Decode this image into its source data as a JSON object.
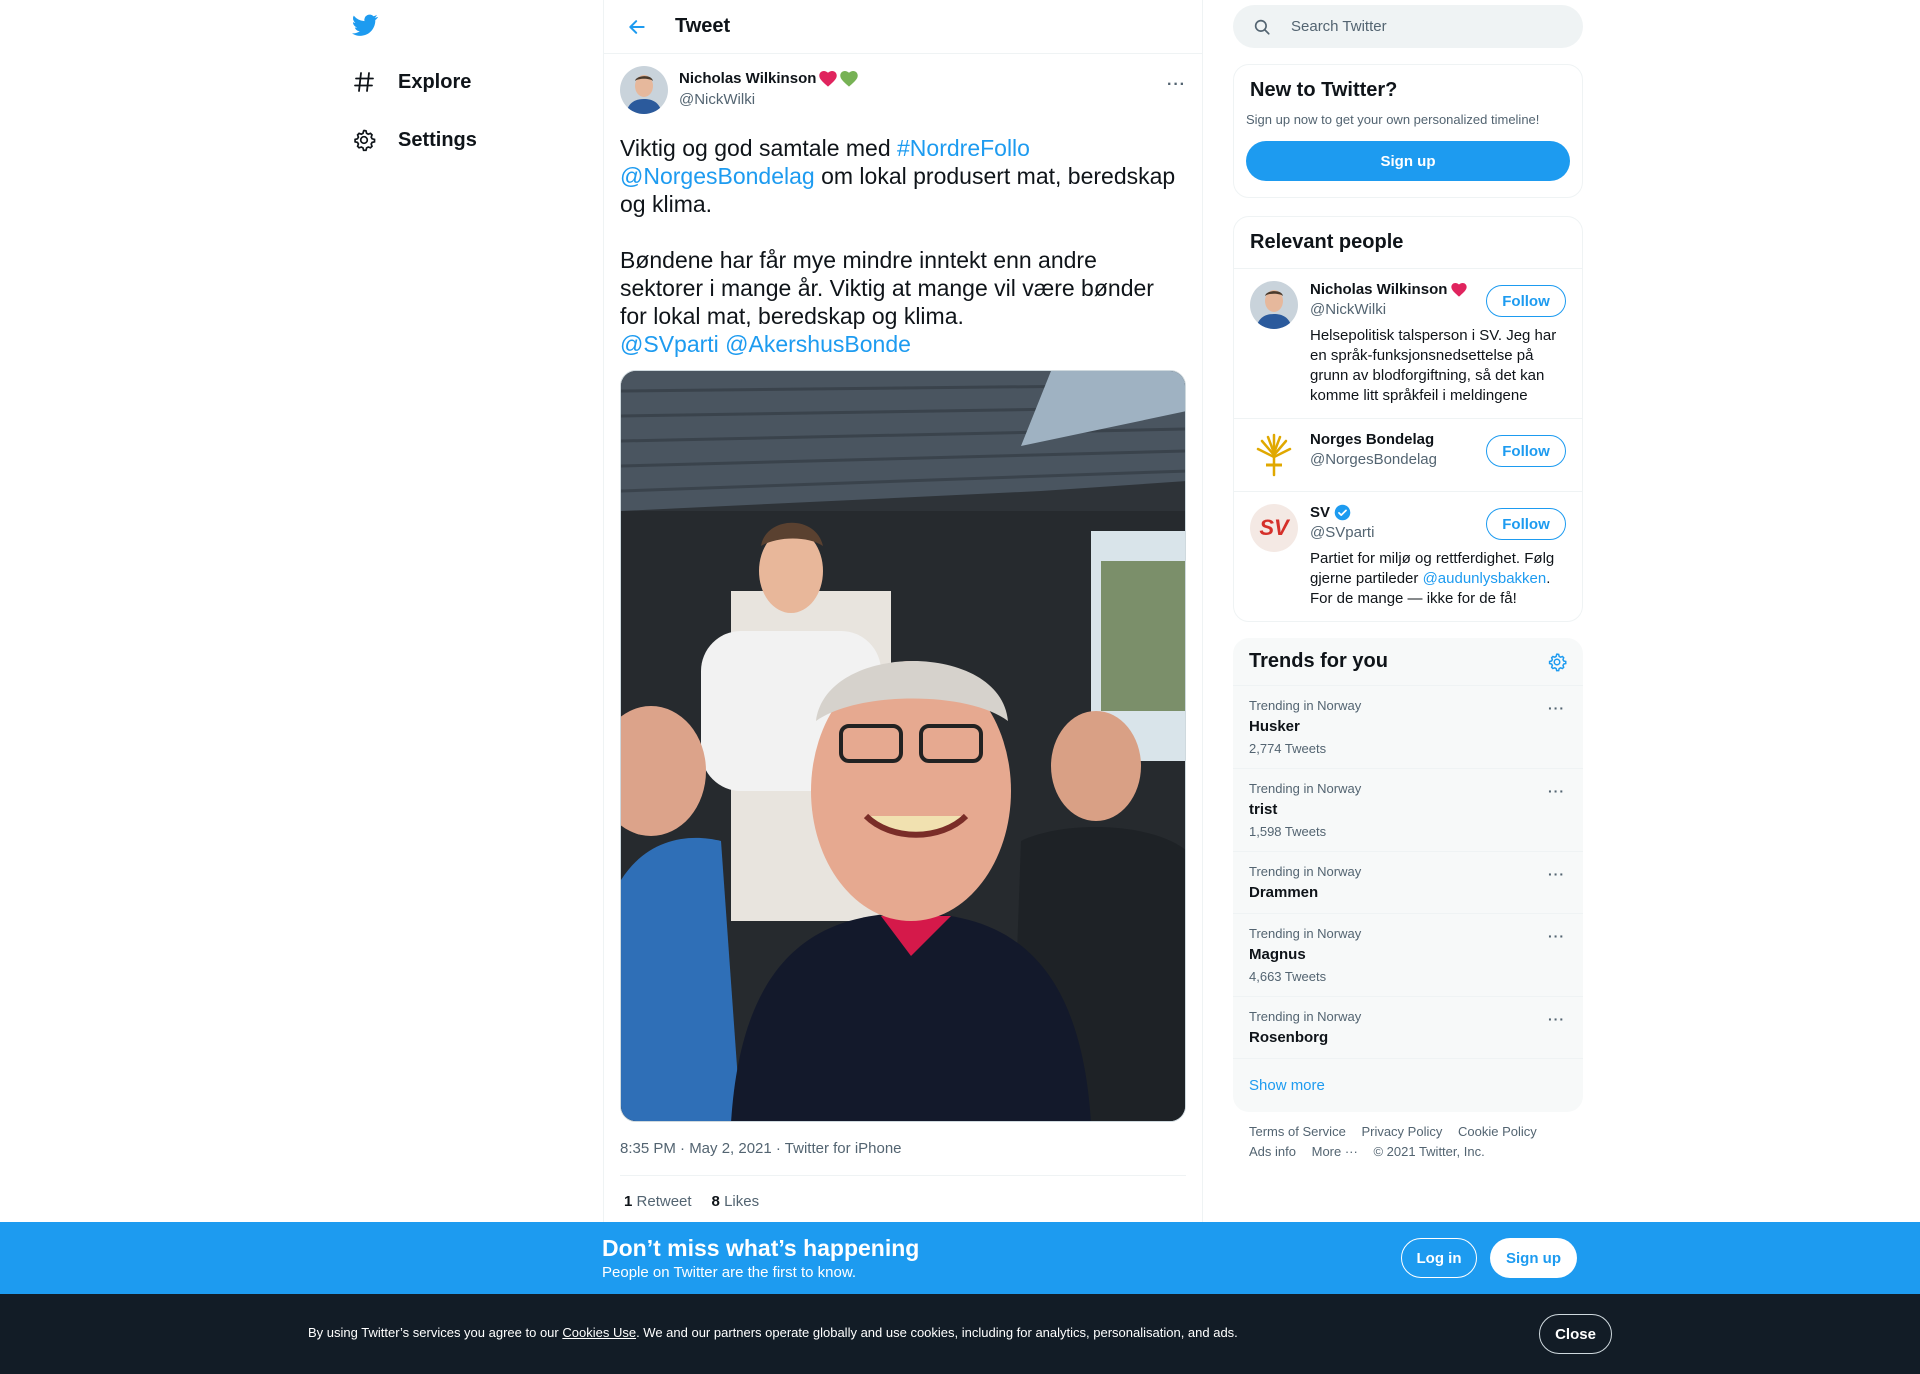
{
  "nav": {
    "explore_label": "Explore",
    "settings_label": "Settings"
  },
  "header": {
    "title": "Tweet"
  },
  "tweet": {
    "author_name": "Nicholas Wilkinson",
    "author_handle": "@NickWilki",
    "more": "···",
    "text": {
      "p1_pre": "Viktig og god samtale med ",
      "p1_hashtag": "#NordreFollo",
      "p1_mention": "@NorgesBondelag",
      "p1_post": " om lokal produsert mat, beredskap og klima.",
      "p2": "Bøndene har får mye mindre inntekt enn andre sektorer i mange år. Viktig at mange vil være bønder for lokal mat, beredskap og klima.",
      "mention_a": "@SVparti",
      "mention_b": "@AkershusBonde"
    },
    "meta": "8:35 PM · May 2, 2021 · Twitter for iPhone",
    "retweets_count": "1",
    "retweets_label": "Retweet",
    "likes_count": "8",
    "likes_label": "Likes"
  },
  "search": {
    "placeholder": "Search Twitter"
  },
  "new_to_twitter": {
    "title": "New to Twitter?",
    "subtitle": "Sign up now to get your own personalized timeline!",
    "button": "Sign up"
  },
  "relevant_people": {
    "title": "Relevant people",
    "people": [
      {
        "name": "Nicholas Wilkinson",
        "handle": "@NickWilki",
        "bio": "Helsepolitisk talsperson i SV. Jeg har en språk-funksjonsnedsettelse på grunn av blodforgiftning, så det kan komme litt språkfeil i meldingene",
        "follow": "Follow"
      },
      {
        "name": "Norges Bondelag",
        "handle": "@NorgesBondelag",
        "follow": "Follow"
      },
      {
        "name": "SV",
        "handle": "@SVparti",
        "bio_pre": "Partiet for miljø og rettferdighet. Følg gjerne partileder ",
        "bio_link": "@audunlysbakken",
        "bio_post": ". For de mange — ikke for de få!",
        "avatar_text": "SV",
        "follow": "Follow"
      }
    ]
  },
  "trends": {
    "title": "Trends for you",
    "items": [
      {
        "context": "Trending in Norway",
        "name": "Husker",
        "count": "2,774 Tweets"
      },
      {
        "context": "Trending in Norway",
        "name": "trist",
        "count": "1,598 Tweets"
      },
      {
        "context": "Trending in Norway",
        "name": "Drammen",
        "count": ""
      },
      {
        "context": "Trending in Norway",
        "name": "Magnus",
        "count": "4,663 Tweets"
      },
      {
        "context": "Trending in Norway",
        "name": "Rosenborg",
        "count": ""
      }
    ],
    "more_dots": "···",
    "show_more": "Show more"
  },
  "footer": {
    "terms": "Terms of Service",
    "privacy": "Privacy Policy",
    "cookie": "Cookie Policy",
    "ads": "Ads info",
    "more": "More ···",
    "copyright": "© 2021 Twitter, Inc."
  },
  "banner": {
    "title": "Don’t miss what’s happening",
    "subtitle": "People on Twitter are the first to know.",
    "login": "Log in",
    "signup": "Sign up"
  },
  "cookie_bar": {
    "pre": "By using Twitter’s services you agree to our ",
    "link": "Cookies Use",
    "post": ". We and our partners operate globally and use cookies, including for analytics, personalisation, and ads.",
    "close": "Close"
  },
  "colors": {
    "accent": "#1d9bf0",
    "banner_bg": "#1d9bf0",
    "cookie_bg": "#121c26",
    "heart_red": "#e0245e",
    "heart_green": "#77b255"
  },
  "icons": {
    "logo": "twitter-bird-icon",
    "explore": "hashtag-icon",
    "settings": "gear-icon",
    "back": "back-arrow-icon",
    "search": "search-icon",
    "verified": "verified-badge-icon"
  }
}
